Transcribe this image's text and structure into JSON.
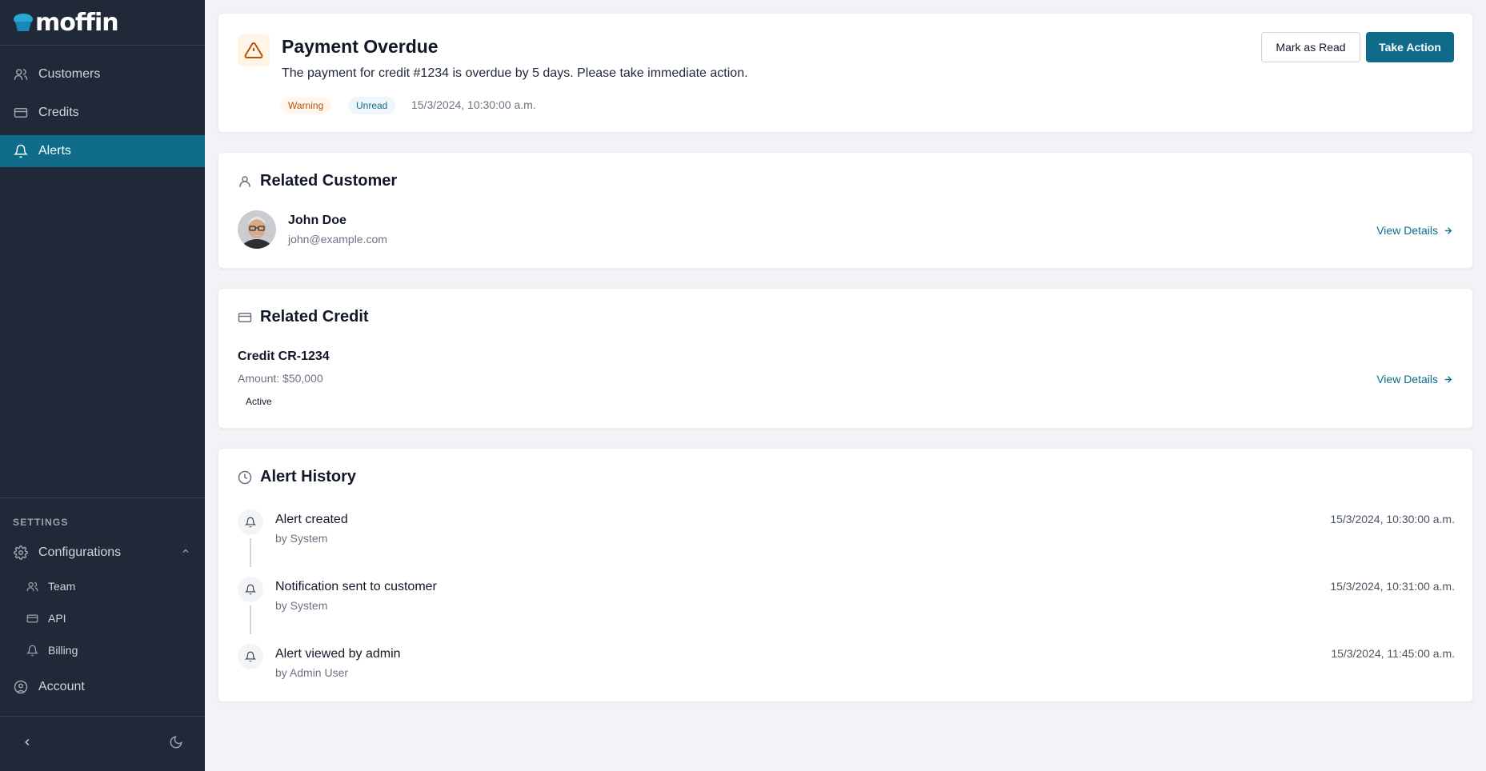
{
  "app": {
    "name": "moffin"
  },
  "colors": {
    "accent": "#0e6c8a",
    "sidebar": "#1f2937",
    "warning": "#b45309"
  },
  "sidebar": {
    "items": [
      {
        "label": "Customers",
        "icon": "users-icon"
      },
      {
        "label": "Credits",
        "icon": "credit-card-icon"
      },
      {
        "label": "Alerts",
        "icon": "bell-icon",
        "active": true
      }
    ],
    "settings_label": "SETTINGS",
    "configurations": {
      "label": "Configurations",
      "icon": "gear-icon",
      "expanded": true,
      "children": [
        {
          "label": "Team",
          "icon": "users-icon"
        },
        {
          "label": "API",
          "icon": "credit-card-icon"
        },
        {
          "label": "Billing",
          "icon": "bell-icon"
        }
      ]
    },
    "account_label": "Account"
  },
  "alert": {
    "title": "Payment Overdue",
    "message": "The payment for credit #1234 is overdue by 5 days. Please take immediate action.",
    "badges": [
      "Warning",
      "Unread"
    ],
    "timestamp": "15/3/2024, 10:30:00 a.m.",
    "actions": {
      "mark_read": "Mark as Read",
      "take_action": "Take Action"
    }
  },
  "related_customer": {
    "section_title": "Related Customer",
    "name": "John Doe",
    "email": "john@example.com",
    "link": "View Details"
  },
  "related_credit": {
    "section_title": "Related Credit",
    "id": "Credit CR-1234",
    "amount": "Amount: $50,000",
    "status": "Active",
    "link": "View Details"
  },
  "history": {
    "section_title": "Alert History",
    "entries": [
      {
        "action": "Alert created",
        "by": "by System",
        "time": "15/3/2024, 10:30:00 a.m."
      },
      {
        "action": "Notification sent to customer",
        "by": "by System",
        "time": "15/3/2024, 10:31:00 a.m."
      },
      {
        "action": "Alert viewed by admin",
        "by": "by Admin User",
        "time": "15/3/2024, 11:45:00 a.m."
      }
    ]
  }
}
